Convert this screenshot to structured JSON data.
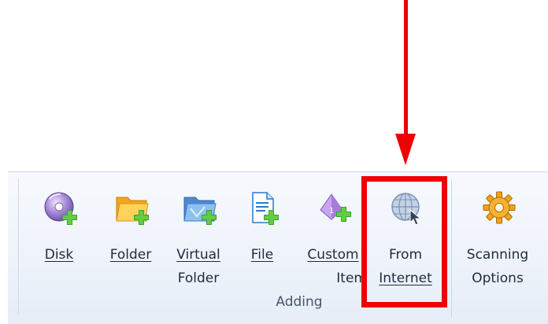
{
  "ribbon": {
    "group_label": "Adding",
    "buttons": [
      {
        "name": "disk",
        "line1": "Disk",
        "line2": "",
        "icon": "disk-add-icon"
      },
      {
        "name": "folder",
        "line1": "Folder",
        "line2": "",
        "icon": "folder-add-icon"
      },
      {
        "name": "virtual-folder",
        "line1": "Virtual",
        "line2": "Folder",
        "icon": "virtual-folder-add-icon"
      },
      {
        "name": "file",
        "line1": "File",
        "line2": "",
        "icon": "file-add-icon"
      },
      {
        "name": "custom-item",
        "line1": "Custom",
        "line2": "Item",
        "icon": "custom-item-add-icon"
      },
      {
        "name": "from-internet",
        "line1": "From",
        "line2": "Internet",
        "icon": "globe-cursor-icon"
      },
      {
        "name": "scanning-options",
        "line1": "Scanning",
        "line2": "Options",
        "icon": "gear-icon"
      }
    ]
  },
  "annotation": {
    "color": "#ee0000",
    "target": "from-internet"
  }
}
